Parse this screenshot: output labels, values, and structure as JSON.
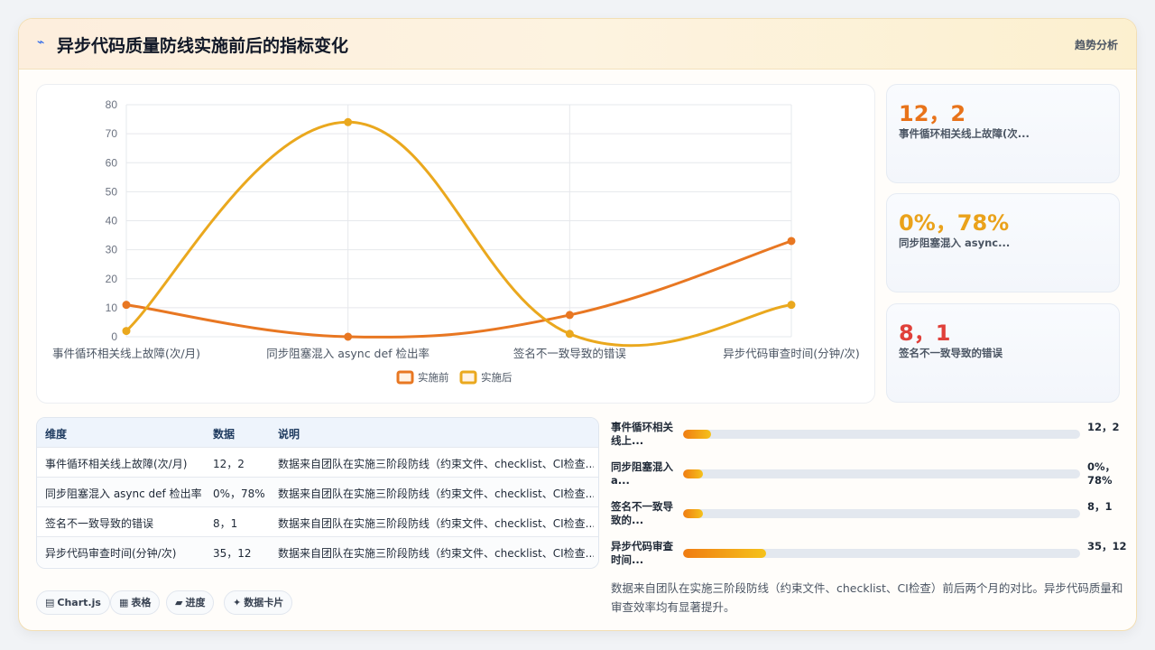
{
  "header": {
    "icon": "lightning-icon",
    "title": "异步代码质量防线实施前后的指标变化",
    "badge": "趋势分析"
  },
  "chart_data": {
    "type": "line",
    "categories": [
      "事件循环相关线上故障(次/月)",
      "同步阻塞混入 async def 检出率",
      "签名不一致导致的错误",
      "异步代码审查时间(分钟/次)"
    ],
    "series": [
      {
        "name": "实施前",
        "values": [
          11,
          0,
          7.5,
          33
        ],
        "color": "#e87722"
      },
      {
        "name": "实施后",
        "values": [
          2,
          74,
          1,
          11
        ],
        "color": "#eaa81e"
      }
    ],
    "ylim": [
      0,
      80
    ],
    "yticks": [
      "0",
      "10",
      "20",
      "30",
      "40",
      "50",
      "60",
      "70",
      "80"
    ],
    "grid": true,
    "legend": "bottom"
  },
  "stats": [
    {
      "value": "12，2",
      "label": "事件循环相关线上故障(次...",
      "color": "#e8731a"
    },
    {
      "value": "0%，78%",
      "label": "同步阻塞混入 async...",
      "color": "#eaa21b"
    },
    {
      "value": "8，1",
      "label": "签名不一致导致的错误",
      "color": "#e0403a"
    }
  ],
  "table": {
    "headers": [
      "维度",
      "数据",
      "说明"
    ],
    "rows": [
      [
        "事件循环相关线上故障(次/月)",
        "12，2",
        "数据来自团队在实施三阶段防线（约束文件、checklist、CI检查..."
      ],
      [
        "同步阻塞混入 async def 检出率",
        "0%，78%",
        "数据来自团队在实施三阶段防线（约束文件、checklist、CI检查..."
      ],
      [
        "签名不一致导致的错误",
        "8，1",
        "数据来自团队在实施三阶段防线（约束文件、checklist、CI检查..."
      ],
      [
        "异步代码审查时间(分钟/次)",
        "35，12",
        "数据来自团队在实施三阶段防线（约束文件、checklist、CI检查..."
      ]
    ]
  },
  "progress": [
    {
      "label": "事件循环相关线上...",
      "value": "12，2",
      "fraction": 0.07
    },
    {
      "label": "同步阻塞混入 a...",
      "value": "0%，78%",
      "fraction": 0.05
    },
    {
      "label": "签名不一致导致的...",
      "value": "8，1",
      "fraction": 0.05
    },
    {
      "label": "异步代码审查时间...",
      "value": "35，12",
      "fraction": 0.21
    }
  ],
  "note": "数据来自团队在实施三阶段防线（约束文件、checklist、CI检查）前后两个月的对比。异步代码质量和审查效率均有显著提升。",
  "chips": [
    {
      "icon": "▤",
      "label": "Chart.js"
    },
    {
      "icon": "▦",
      "label": "表格"
    },
    {
      "icon": "▰",
      "label": "进度"
    },
    {
      "icon": "✦",
      "label": "数据卡片"
    }
  ]
}
